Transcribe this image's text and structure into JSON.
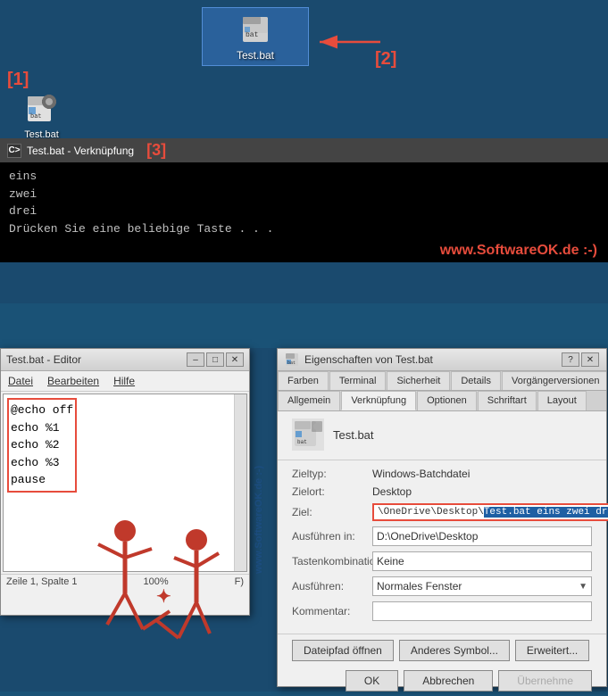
{
  "desktop": {
    "background_color": "#1a4a6e",
    "selected_icon": {
      "label": "Test.bat",
      "position": "top-center"
    },
    "normal_icon": {
      "label": "Test.bat",
      "position": "left"
    },
    "labels": {
      "bracket_1": "[1]",
      "bracket_2": "[2]",
      "bracket_3": "[3]"
    }
  },
  "cmd_window": {
    "title": "Test.bat - Verknüpfung",
    "lines": [
      "eins",
      "zwei",
      "drei",
      "Drücken Sie eine beliebige Taste . . ."
    ],
    "watermark": "www.SoftwareOK.de :-)"
  },
  "notepad_window": {
    "title": "Test.bat - Editor",
    "menu_items": [
      "Datei",
      "Bearbeiten",
      "Hilfe"
    ],
    "content_lines": [
      "@echo off",
      "echo %1",
      "echo %2",
      "echo %3",
      "pause"
    ],
    "status_bar": {
      "position": "Zeile 1, Spalte 1",
      "info": "100%",
      "encoding": "F)"
    }
  },
  "properties_window": {
    "title": "Eigenschaften von Test.bat",
    "tabs_top": [
      "Farben",
      "Terminal",
      "Sicherheit",
      "Details",
      "Vorgängerversionen"
    ],
    "tabs_bottom": [
      "Allgemein",
      "Verknüpfung",
      "Optionen",
      "Schriftart",
      "Layout"
    ],
    "active_tab": "Verknüpfung",
    "icon_filename": "Test.bat",
    "fields": [
      {
        "label": "Zieltyp:",
        "value": "Windows-Batchdatei",
        "type": "text"
      },
      {
        "label": "Zielort:",
        "value": "Desktop",
        "type": "text"
      },
      {
        "label": "Ziel:",
        "value": "\\OneDrive\\Desktop\\Test.bat eins zwei drei",
        "type": "input-highlighted",
        "prefix": "\\OneDrive\\Desktop\\",
        "selected": "Test.bat eins zwei drei"
      },
      {
        "label": "Ausführen in:",
        "value": "D:\\OneDrive\\Desktop",
        "type": "input"
      },
      {
        "label": "Tastenkombination:",
        "value": "Keine",
        "type": "input"
      },
      {
        "label": "Ausführen:",
        "value": "Normales Fenster",
        "type": "select"
      },
      {
        "label": "Kommentar:",
        "value": "",
        "type": "input"
      }
    ],
    "action_buttons": [
      "Dateipfad öffnen",
      "Anderes Symbol...",
      "Erweitert..."
    ],
    "ok_buttons": [
      "OK",
      "Abbrechen",
      "Übernehme"
    ]
  },
  "watermark": {
    "text": "www.SoftwareOK.de :-)"
  }
}
